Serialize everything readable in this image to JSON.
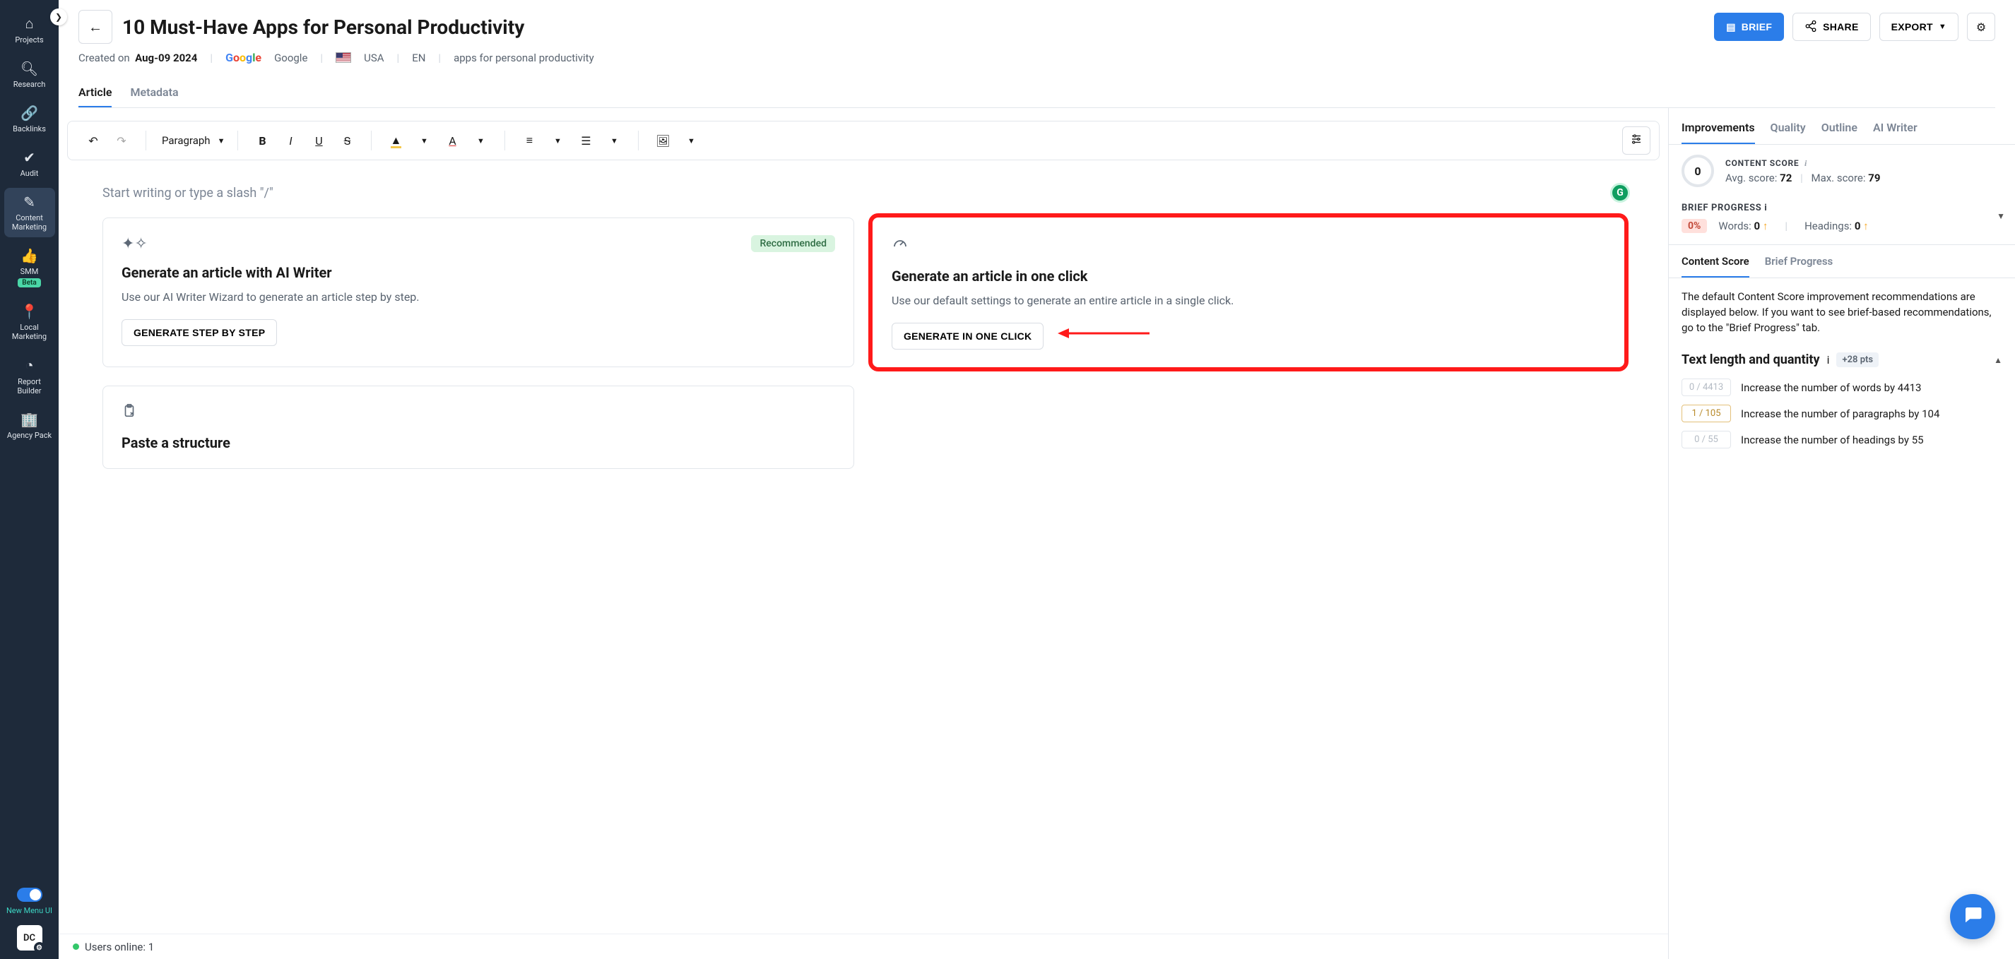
{
  "sidebar": {
    "items": [
      {
        "label": "Projects"
      },
      {
        "label": "Research"
      },
      {
        "label": "Backlinks"
      },
      {
        "label": "Audit"
      },
      {
        "label": "Content Marketing"
      },
      {
        "label": "SMM",
        "badge": "Beta"
      },
      {
        "label": "Local Marketing"
      },
      {
        "label": "Report Builder"
      },
      {
        "label": "Agency Pack"
      }
    ],
    "new_menu_label": "New Menu UI",
    "user_initials": "DC"
  },
  "header": {
    "title": "10 Must-Have Apps for Personal Productivity",
    "brief_btn": "BRIEF",
    "share_btn": "SHARE",
    "export_btn": "EXPORT",
    "meta": {
      "created_label": "Created on",
      "created_date": "Aug-09 2024",
      "search_engine": "Google",
      "country": "USA",
      "language": "EN",
      "keyword": "apps for personal productivity"
    }
  },
  "tabs": [
    {
      "label": "Article",
      "active": true
    },
    {
      "label": "Metadata"
    }
  ],
  "toolbar": {
    "paragraph_label": "Paragraph"
  },
  "editor": {
    "placeholder": "Start writing or type a slash \"/\"",
    "grammarly_initial": "G"
  },
  "cards": {
    "ai_writer": {
      "title": "Generate an article with AI Writer",
      "desc": "Use our AI Writer Wizard to generate an article step by step.",
      "button": "GENERATE STEP BY STEP",
      "recommended": "Recommended"
    },
    "one_click": {
      "title": "Generate an article in one click",
      "desc": "Use our default settings to generate an entire article in a single click.",
      "button": "GENERATE IN ONE CLICK"
    },
    "paste": {
      "title": "Paste a structure"
    }
  },
  "status_bar": {
    "users_online_label": "Users online:",
    "users_online_value": "1"
  },
  "right_panel": {
    "tabs": [
      {
        "label": "Improvements",
        "active": true
      },
      {
        "label": "Quality"
      },
      {
        "label": "Outline"
      },
      {
        "label": "AI Writer"
      }
    ],
    "score": {
      "label": "CONTENT SCORE",
      "value": "0",
      "avg_label": "Avg. score:",
      "avg_value": "72",
      "max_label": "Max. score:",
      "max_value": "79"
    },
    "brief": {
      "label": "BRIEF PROGRESS",
      "percent": "0%",
      "words_label": "Words:",
      "words_value": "0",
      "headings_label": "Headings:",
      "headings_value": "0"
    },
    "subtabs": [
      {
        "label": "Content Score",
        "active": true
      },
      {
        "label": "Brief Progress"
      }
    ],
    "description": "The default Content Score improvement recommendations are displayed below. If you want to see brief-based recommendations, go to the \"Brief Progress\" tab.",
    "section": {
      "title": "Text length and quantity",
      "points": "+28 pts"
    },
    "metrics": [
      {
        "badge": "0 / 4413",
        "text": "Increase the number of words by 4413",
        "faded": true
      },
      {
        "badge": "1 / 105",
        "text": "Increase the number of paragraphs by 104"
      },
      {
        "badge": "0 / 55",
        "text": "Increase the number of headings by 55",
        "faded": true
      }
    ]
  }
}
